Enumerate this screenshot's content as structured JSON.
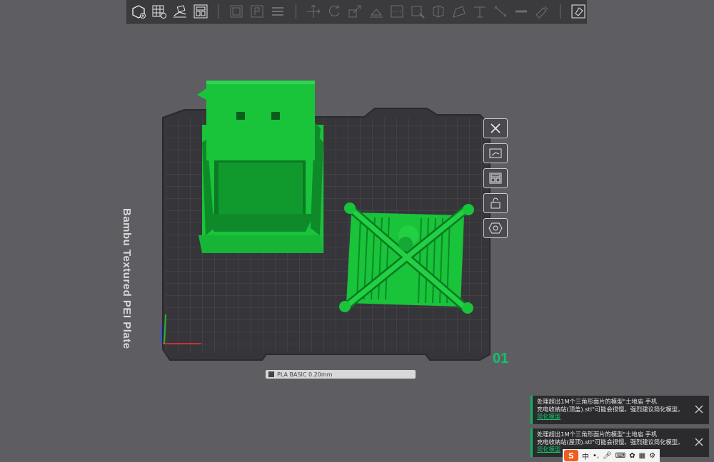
{
  "toolbar": {
    "icons": [
      "add-object-icon",
      "grid-plate-icon",
      "auto-orient-icon",
      "arrange-icon",
      "split-objects-icon",
      "split-parts-icon",
      "layers-icon",
      "move-icon",
      "rotate-icon",
      "scale-icon",
      "lay-on-face-icon",
      "cut-icon",
      "support-paint-icon",
      "seam-paint-icon",
      "color-paint-icon",
      "measure-icon",
      "text-icon",
      "assemble-icon",
      "variable-layer-icon",
      "view-icon"
    ]
  },
  "plate": {
    "label": "Bambu Textured PEI Plate",
    "number": "01",
    "badge_text": "PLA  BASIC  0.20mm"
  },
  "side_tools": [
    "close-plate-icon",
    "auto-orient-plate-icon",
    "arrange-plate-icon",
    "lock-plate-icon",
    "plate-settings-icon"
  ],
  "notifications": [
    {
      "line1": "处理超出1M个三角形面片的模型\"土地庙 手机",
      "line2": "充电收纳站(顶盖).stl\"可能会很慢。强烈建议简化模型。",
      "link": "简化模型"
    },
    {
      "line1": "处理超出1M个三角形面片的模型\"土地庙 手机",
      "line2": "充电收纳站(屋顶).stl\"可能会很慢。强烈建议简化模型。",
      "link": "简化模型"
    }
  ],
  "ime": {
    "logo": "S",
    "mode": "中",
    "punct": "•,"
  },
  "colors": {
    "model_green": "#19c33a",
    "accent_green": "#13c26b",
    "plate_dark": "#35353a",
    "grid_line": "#4a4a50",
    "background": "#5e5e62"
  }
}
